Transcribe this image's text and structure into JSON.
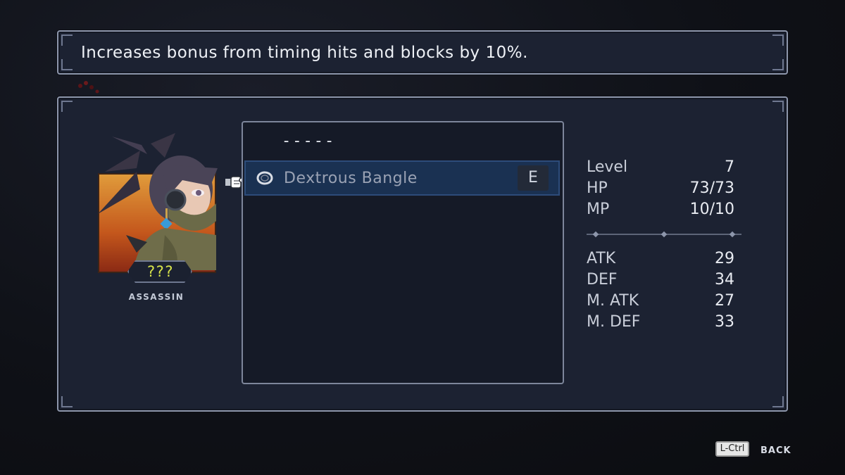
{
  "description": {
    "text": "Increases bonus from timing hits and blocks by 10%."
  },
  "character": {
    "name": "???",
    "class": "ASSASSIN",
    "portrait_icon": "assassin-portrait"
  },
  "equipment": {
    "empty_slot": "-----",
    "selected_item": {
      "name": "Dextrous Bangle",
      "icon": "ring-icon",
      "badge": "E"
    }
  },
  "stats": {
    "primary": [
      {
        "label": "Level",
        "value": "7"
      },
      {
        "label": "HP",
        "value": "73/73"
      },
      {
        "label": "MP",
        "value": "10/10"
      }
    ],
    "combat": [
      {
        "label": "ATK",
        "value": "29"
      },
      {
        "label": "DEF",
        "value": "34"
      },
      {
        "label": "M. ATK",
        "value": "27"
      },
      {
        "label": "M. DEF",
        "value": "33"
      }
    ]
  },
  "controls": {
    "back_key": "L-Ctrl",
    "back_label": "BACK"
  },
  "colors": {
    "panel_bg": "#1c2232",
    "selection": "#1a3152",
    "name_text": "#d7e34a",
    "portrait_warm": "#e09b3b"
  }
}
